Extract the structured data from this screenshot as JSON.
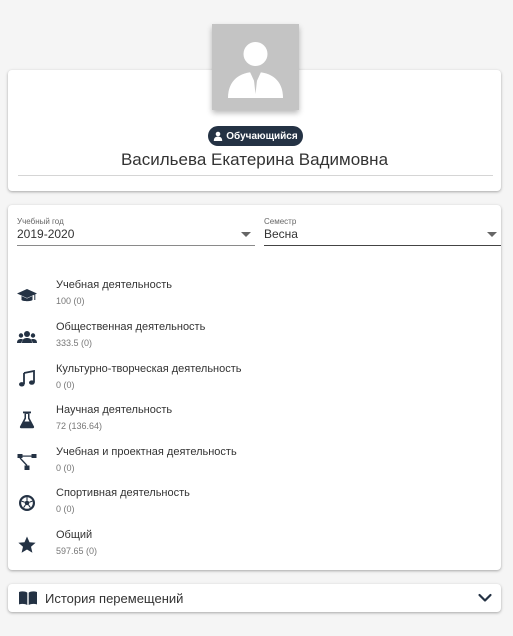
{
  "profile": {
    "role_badge": "Обучающийся",
    "name": "Васильева Екатерина Вадимовна"
  },
  "filters": {
    "year_label": "Учебный год",
    "year_value": "2019-2020",
    "term_label": "Семестр",
    "term_value": "Весна"
  },
  "activities": [
    {
      "title": "Учебная деятельность",
      "value": "100 (0)",
      "icon": "graduation-cap-icon"
    },
    {
      "title": "Общественная деятельность",
      "value": "333.5 (0)",
      "icon": "users-icon"
    },
    {
      "title": "Культурно-творческая деятельность",
      "value": "0 (0)",
      "icon": "music-note-icon"
    },
    {
      "title": "Научная деятельность",
      "value": "72 (136.64)",
      "icon": "flask-icon"
    },
    {
      "title": "Учебная и проектная деятельность",
      "value": "0 (0)",
      "icon": "project-diagram-icon"
    },
    {
      "title": "Спортивная деятельность",
      "value": "0 (0)",
      "icon": "soccer-ball-icon"
    },
    {
      "title": "Общий",
      "value": "597.65 (0)",
      "icon": "star-icon"
    }
  ],
  "history": {
    "label": "История перемещений",
    "icon": "book-open-icon"
  },
  "colors": {
    "badge_bg": "#243244",
    "icon": "#243244",
    "avatar_bg": "#c4c4c4"
  }
}
